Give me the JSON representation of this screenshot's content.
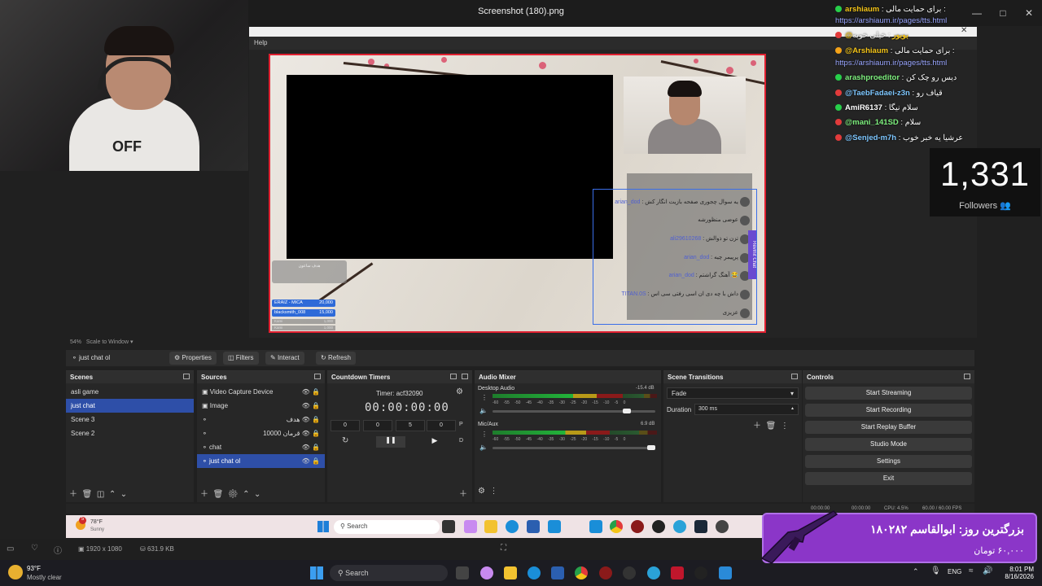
{
  "viewer": {
    "title": "Screenshot (180).png",
    "status_dims": "1920 x 1080",
    "status_size": "631.9 KB"
  },
  "obs": {
    "menu_help": "Help",
    "zoom_label": "54%",
    "zoom_mode": "Scale to Window",
    "selected_source": "just chat ol",
    "prop_buttons": [
      "Properties",
      "Filters",
      "Interact",
      "Refresh"
    ],
    "scenes": {
      "title": "Scenes",
      "items": [
        "asli game",
        "just chat",
        "Scene 3",
        "Scene 2"
      ],
      "selected_index": 1
    },
    "sources": {
      "title": "Sources",
      "items": [
        "Video Capture Device",
        "Image",
        "هدف",
        "10000 قرمان",
        "chat",
        "just chat ol"
      ],
      "selected_index": 5
    },
    "countdown": {
      "title": "Countdown Timers",
      "timer_label": "Timer: acf32090",
      "display": [
        "00",
        "00",
        "00",
        "00"
      ],
      "inputs": [
        "0",
        "0",
        "5",
        "0"
      ],
      "p_label": "P",
      "d_label": "D"
    },
    "audio": {
      "title": "Audio Mixer",
      "channels": [
        {
          "name": "Desktop Audio",
          "db": "-15.4 dB",
          "volume": 0.84
        },
        {
          "name": "Mic/Aux",
          "db": "6.9 dB",
          "volume": 1.0
        }
      ],
      "scale": "-60 -55 -50 -45 -40 -35 -30 -25 -20 -15 -10 -5 0"
    },
    "transitions": {
      "title": "Scene Transitions",
      "selected": "Fade",
      "duration_label": "Duration",
      "duration_value": "300 ms"
    },
    "controls": {
      "title": "Controls",
      "buttons": [
        "Start Streaming",
        "Start Recording",
        "Start Replay Buffer",
        "Studio Mode",
        "Settings",
        "Exit"
      ]
    },
    "status": {
      "time1": "00:00:00",
      "time2": "00:00:00",
      "cpu": "CPU: 4.5%",
      "fps": "60.00 / 60.00 FPS"
    },
    "preview": {
      "goal_title": "هدف ساعون",
      "donations": [
        {
          "name": "ERAIZ - MICA",
          "amount": "20,000"
        },
        {
          "name": "blacksmith_008",
          "amount": "15,000"
        }
      ],
      "small_rows": [
        {
          "name": "Kami",
          "amount": "1,000"
        },
        {
          "name": "Kami",
          "amount": "1,000"
        }
      ],
      "chat": [
        {
          "user": "arian_dod",
          "msg": "یه سوال چجوری صفحه بازیت انگار کش"
        },
        {
          "user": "",
          "msg": "عوضی منظورشه"
        },
        {
          "user": "ali29610268",
          "msg": "تزن تو ذوالش"
        },
        {
          "user": "arian_dod",
          "msg": "پرپیمر چیه"
        },
        {
          "user": "arian_dod",
          "msg": "آهنگ گراشتم 😂"
        },
        {
          "user": "TITAN.0S",
          "msg": "داش با چه دی ان اسی رفتی سی اس"
        },
        {
          "user": "",
          "msg": "عزیزی"
        }
      ],
      "revchat_label": "Revmit Chat"
    }
  },
  "inner_taskbar": {
    "weather_temp": "78°F",
    "weather_desc": "Sunny",
    "search": "Search",
    "badge": "5"
  },
  "taskbar": {
    "weather_temp": "93°F",
    "weather_desc": "Mostly clear",
    "search": "Search",
    "lang": "ENG",
    "time": "8:01 PM",
    "date": "8/16/2026"
  },
  "overlay": {
    "chat": [
      {
        "user": "arshiaum",
        "msg": "برای حمایت مالی :",
        "color": "#f5c518",
        "badge": "#27d04a"
      },
      {
        "user": "",
        "msg": "https://arshiaum.ir/pages/tts.html",
        "color": "#9aa6ff",
        "badge": ""
      },
      {
        "user": "@بوبور",
        "msg": "خیلی خوبه",
        "color": "#f5c518",
        "badge": "#e23b3b"
      },
      {
        "user": "",
        "msg": "برای حمایت مالی :",
        "color": "#ffffff",
        "badge": "#e23b3b"
      },
      {
        "user": "@Arshiaum",
        "msg": "",
        "color": "#f5c518",
        "badge": "#f5a318"
      },
      {
        "user": "",
        "msg": "https://arshiaum.ir/pages/tts.html",
        "color": "#9aa6ff",
        "badge": ""
      },
      {
        "user": "arashproeditor",
        "msg": "دیس رو چک کن",
        "color": "#7ef07e",
        "badge": "#27d04a"
      },
      {
        "user": "@TaebFadaei-z3n",
        "msg": "قیاف رو",
        "color": "#7ec7ff",
        "badge": "#e23b3b"
      },
      {
        "user": "AmiR6137",
        "msg": "سلام نیگا",
        "color": "#ffffff",
        "badge": "#27d04a"
      },
      {
        "user": "@mani_141SD",
        "msg": "سلام",
        "color": "#7ef07e",
        "badge": "#e23b3b"
      },
      {
        "user": "@Senjed-m7h",
        "msg": "عرشیا یه خبر خوب",
        "color": "#7ec7ff",
        "badge": "#e23b3b"
      }
    ],
    "followers_count": "1,331",
    "followers_label": "Followers",
    "top_donor_title": "بزرگترین روز: ابوالقاسم ۱۸۰۲۸۲",
    "top_donor_amount": "۶۰,۰۰۰ تومان"
  }
}
